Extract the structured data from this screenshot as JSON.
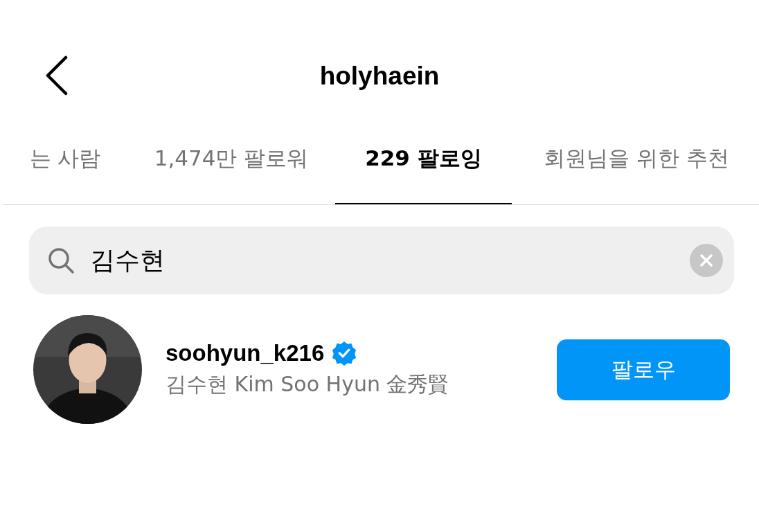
{
  "header": {
    "title": "holyhaein"
  },
  "tabs": [
    {
      "label": "는 사람",
      "selected": false
    },
    {
      "label": "1,474만 팔로워",
      "selected": false
    },
    {
      "label": "229 팔로잉",
      "selected": true
    },
    {
      "label": "회원님을 위한 추천",
      "selected": false
    }
  ],
  "search": {
    "value": "김수현"
  },
  "results": [
    {
      "username": "soohyun_k216",
      "verified": true,
      "full_name": "김수현 Kim Soo Hyun 金秀賢",
      "button": "팔로우"
    }
  ]
}
